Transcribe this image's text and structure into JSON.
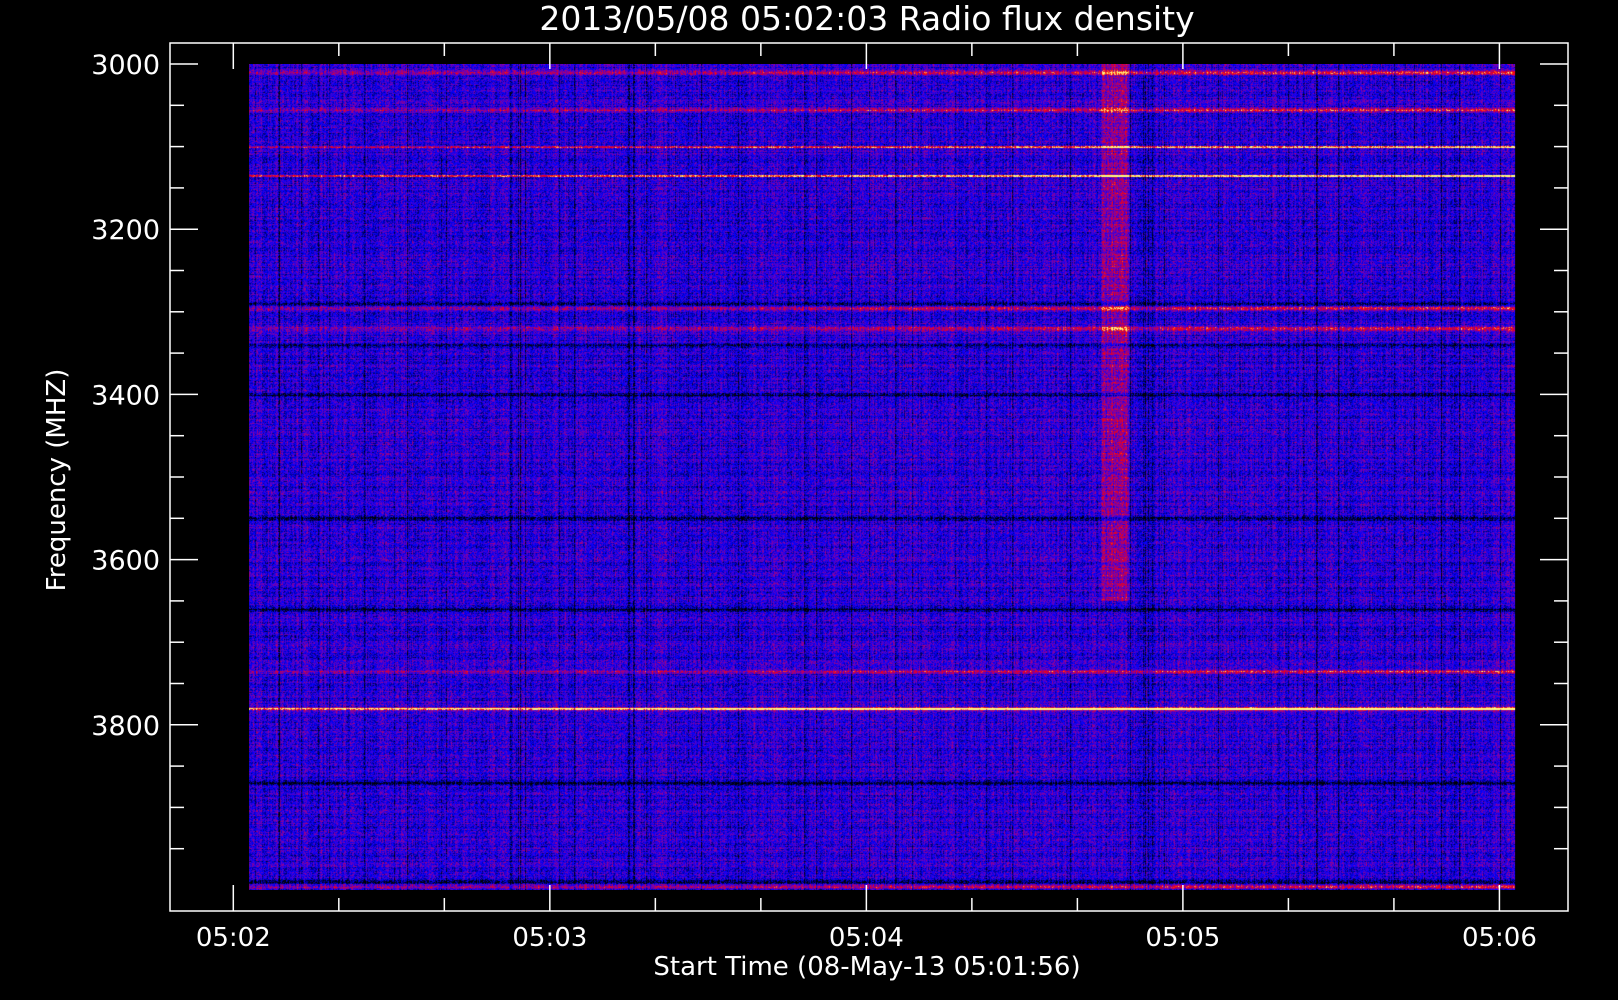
{
  "chart_data": {
    "type": "heatmap",
    "title": "2013/05/08 05:02:03 Radio flux density",
    "xlabel": "Start Time (08-May-13 05:01:56)",
    "ylabel": "Frequency (MHZ)",
    "x_ticks": [
      "05:02",
      "05:03",
      "05:04",
      "05:05",
      "05:06"
    ],
    "y_ticks": [
      "3000",
      "3200",
      "3400",
      "3600",
      "3800"
    ],
    "x_range_seconds_after_0502": [
      -12,
      253
    ],
    "data_time_range_seconds_after_0502": [
      3,
      243
    ],
    "ylim": [
      3000,
      4000
    ],
    "y_axis_inverted": true,
    "colormap": [
      "#000000",
      "#0000ff",
      "#7f00a0",
      "#ff0000",
      "#ffff80"
    ],
    "background": "#000000",
    "axis_color": "#ffffff",
    "notable_features": {
      "strong_red_bands_mhz": [
        3010,
        3055,
        3295,
        3320,
        3735,
        3780,
        3995
      ],
      "dark_bands_mhz": [
        3290,
        3340,
        3400,
        3550,
        3660,
        3870,
        3990
      ],
      "bright_yellow_bands_mhz": [
        3100,
        3135,
        3780
      ],
      "vertical_red_column_time": "05:04:47"
    }
  }
}
